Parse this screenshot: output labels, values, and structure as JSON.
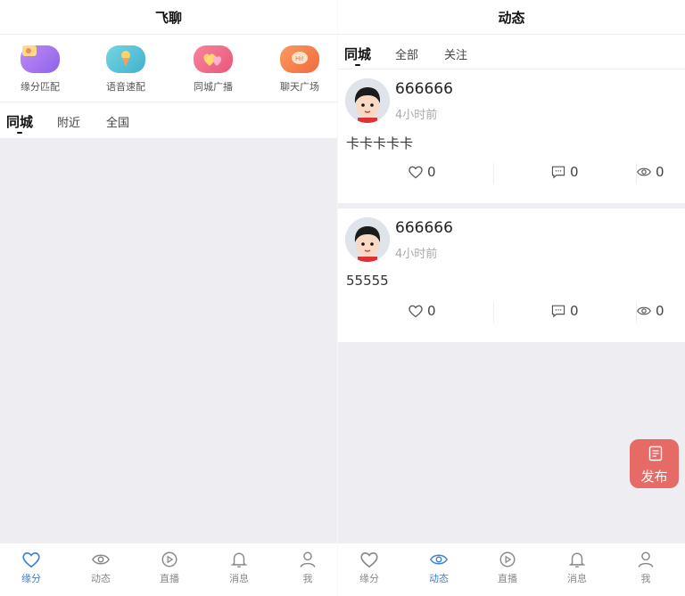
{
  "left": {
    "title": "飞聊",
    "features": [
      {
        "label": "缘分匹配",
        "icon": "chat-bubble-icon",
        "color": "#a77bf0"
      },
      {
        "label": "语音速配",
        "icon": "ice-cream-icon",
        "color": "#5ec5d8"
      },
      {
        "label": "同城广播",
        "icon": "heart-icon",
        "color": "#f16f8e"
      },
      {
        "label": "聊天广场",
        "icon": "hi-bubble-icon",
        "color": "#f7834e"
      }
    ],
    "tabs": [
      "同城",
      "附近",
      "全国"
    ],
    "active_tab": "同城"
  },
  "right": {
    "title": "动态",
    "tabs": [
      "同城",
      "全部",
      "关注"
    ],
    "active_tab": "同城",
    "posts": [
      {
        "username": "666666",
        "time": "4小时前",
        "content": "卡卡卡卡卡",
        "likes": "0",
        "comments": "0",
        "views": "0"
      },
      {
        "username": "666666",
        "time": "4小时前",
        "content": "55555",
        "likes": "0",
        "comments": "0",
        "views": "0"
      }
    ],
    "fab_label": "发布"
  },
  "tabbar": {
    "items": [
      {
        "label": "缘分",
        "icon": "heart-outline-icon"
      },
      {
        "label": "动态",
        "icon": "eye-icon"
      },
      {
        "label": "直播",
        "icon": "play-circle-icon"
      },
      {
        "label": "消息",
        "icon": "bell-icon"
      },
      {
        "label": "我",
        "icon": "person-icon"
      }
    ],
    "left_active": "缘分",
    "right_active": "动态",
    "active_color": "#3d7fd6",
    "inactive_color": "#888888"
  }
}
